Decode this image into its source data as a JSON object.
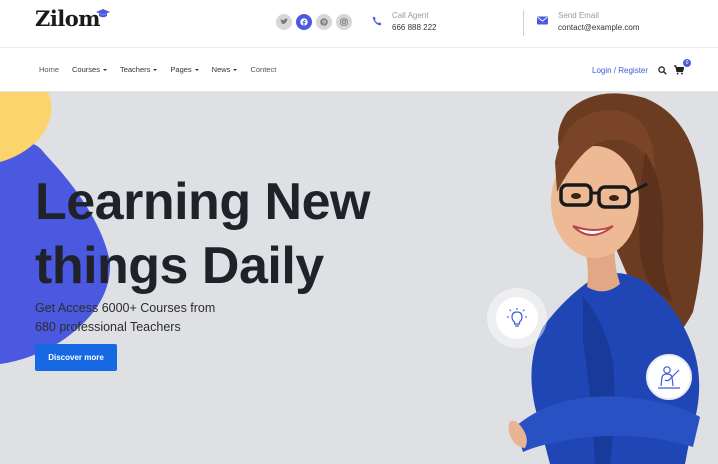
{
  "header": {
    "logo_text": "Zilom",
    "social_icons": [
      "twitter-icon",
      "facebook-icon",
      "pinterest-icon",
      "instagram-icon"
    ],
    "call": {
      "label": "Call Agent",
      "value": "666 888 222"
    },
    "email": {
      "label": "Send Email",
      "value": "contact@example.com"
    }
  },
  "nav": {
    "items": [
      {
        "label": "Home",
        "dropdown": false
      },
      {
        "label": "Courses",
        "dropdown": true
      },
      {
        "label": "Teachers",
        "dropdown": true
      },
      {
        "label": "Pages",
        "dropdown": true
      },
      {
        "label": "News",
        "dropdown": true
      },
      {
        "label": "Contect",
        "dropdown": false
      }
    ],
    "login_label": "Login / Register",
    "cart_count": "0"
  },
  "hero": {
    "title_line1": "Learning New",
    "title_line2": "things Daily",
    "subtitle_line1": "Get Access 6000+ Courses from",
    "subtitle_line2": "680 professional Teachers",
    "cta_label": "Discover more"
  },
  "colors": {
    "accent": "#4a5be0",
    "button": "#1668e3",
    "hero_bg": "#dfe0e3",
    "blob_blue": "#4a59df",
    "blob_yellow": "#fbd46b"
  }
}
